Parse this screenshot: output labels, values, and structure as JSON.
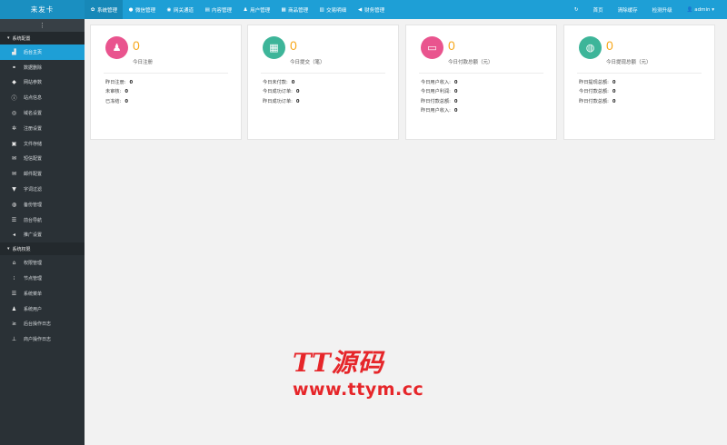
{
  "brand": "来发卡",
  "topnav": [
    {
      "label": "系统管理",
      "icon": "gear-icon",
      "glyph": "✿",
      "active": true
    },
    {
      "label": "微信管理",
      "icon": "chat-icon",
      "glyph": "●"
    },
    {
      "label": "网关通道",
      "icon": "gateway-icon",
      "glyph": "◉"
    },
    {
      "label": "内容管理",
      "icon": "document-icon",
      "glyph": "▤"
    },
    {
      "label": "用户管理",
      "icon": "users-icon",
      "glyph": "♟"
    },
    {
      "label": "商品管理",
      "icon": "shop-icon",
      "glyph": "▦"
    },
    {
      "label": "交易明细",
      "icon": "chart-icon",
      "glyph": "▥"
    },
    {
      "label": "财务管理",
      "icon": "megaphone-icon",
      "glyph": "◀"
    }
  ],
  "topright": {
    "refresh_glyph": "↻",
    "home": "首页",
    "clear_cache": "清除缓存",
    "upgrade": "检测升级",
    "admin": "admin ▾",
    "admin_glyph": "👤"
  },
  "sidebar": {
    "toggle": "⋮",
    "groups": [
      {
        "title": "系统配置",
        "items": [
          {
            "label": "后台主页",
            "icon": "area-chart-icon",
            "glyph": "▟",
            "active": true
          },
          {
            "label": "数据删除",
            "icon": "link-icon",
            "glyph": "⚭"
          },
          {
            "label": "网站参数",
            "icon": "apple-icon",
            "glyph": "◆"
          },
          {
            "label": "站点信息",
            "icon": "info-icon",
            "glyph": "ⓘ"
          },
          {
            "label": "域名设置",
            "icon": "globe-icon",
            "glyph": "◎"
          },
          {
            "label": "注册设置",
            "icon": "cog-icon",
            "glyph": "✲"
          },
          {
            "label": "文件存储",
            "icon": "save-icon",
            "glyph": "▣"
          },
          {
            "label": "短信配置",
            "icon": "mail-icon",
            "glyph": "✉"
          },
          {
            "label": "邮件配置",
            "icon": "envelope-icon",
            "glyph": "✉"
          },
          {
            "label": "字词过滤",
            "icon": "filter-icon",
            "glyph": "▼"
          },
          {
            "label": "备份管理",
            "icon": "database-icon",
            "glyph": "◍"
          },
          {
            "label": "前台导航",
            "icon": "list-icon",
            "glyph": "☰"
          },
          {
            "label": "推广设置",
            "icon": "bullhorn-icon",
            "glyph": "◂"
          }
        ]
      },
      {
        "title": "系统权限",
        "items": [
          {
            "label": "权限管理",
            "icon": "bank-icon",
            "glyph": "⌂"
          },
          {
            "label": "节点管理",
            "icon": "ellipsis-icon",
            "glyph": "⁝"
          },
          {
            "label": "系统菜单",
            "icon": "menu-icon",
            "glyph": "☰"
          },
          {
            "label": "系统用户",
            "icon": "users-icon",
            "glyph": "♟"
          },
          {
            "label": "后台操作日志",
            "icon": "terminal-icon",
            "glyph": "≥"
          },
          {
            "label": "商户操作日志",
            "icon": "pin-icon",
            "glyph": "⊥"
          }
        ]
      }
    ]
  },
  "cards": [
    {
      "value": "0",
      "label": "今日注册",
      "icon": "users-icon",
      "glyph": "♟",
      "color": "#E9548E",
      "stats": [
        {
          "k": "昨日注册:",
          "v": "0"
        },
        {
          "k": "未审核:",
          "v": "0"
        },
        {
          "k": "已冻结:",
          "v": "0"
        }
      ]
    },
    {
      "value": "0",
      "label": "今日提交（笔）",
      "icon": "calendar-icon",
      "glyph": "▦",
      "color": "#3DB599",
      "stats": [
        {
          "k": "今日未付款:",
          "v": "0"
        },
        {
          "k": "今日成功订单:",
          "v": "0"
        },
        {
          "k": "昨日成功订单:",
          "v": "0"
        }
      ]
    },
    {
      "value": "0",
      "label": "今日付款总额（元）",
      "icon": "credit-card-icon",
      "glyph": "▭",
      "color": "#E9548E",
      "stats": [
        {
          "k": "今日用户收入:",
          "v": "0"
        },
        {
          "k": "今日用户利润:",
          "v": "0"
        },
        {
          "k": "昨日付款总额:",
          "v": "0"
        },
        {
          "k": "昨日用户收入:",
          "v": "0"
        }
      ]
    },
    {
      "value": "0",
      "label": "今日提现总额（元）",
      "icon": "database-icon",
      "glyph": "◍",
      "color": "#3DB599",
      "stats": [
        {
          "k": "昨日提现总额:",
          "v": "0"
        },
        {
          "k": "今日付款总额:",
          "v": "0"
        },
        {
          "k": "昨日付款总额:",
          "v": "0"
        }
      ]
    }
  ],
  "watermark": {
    "line1": "TT源码",
    "line2": "www.ttym.cc"
  }
}
